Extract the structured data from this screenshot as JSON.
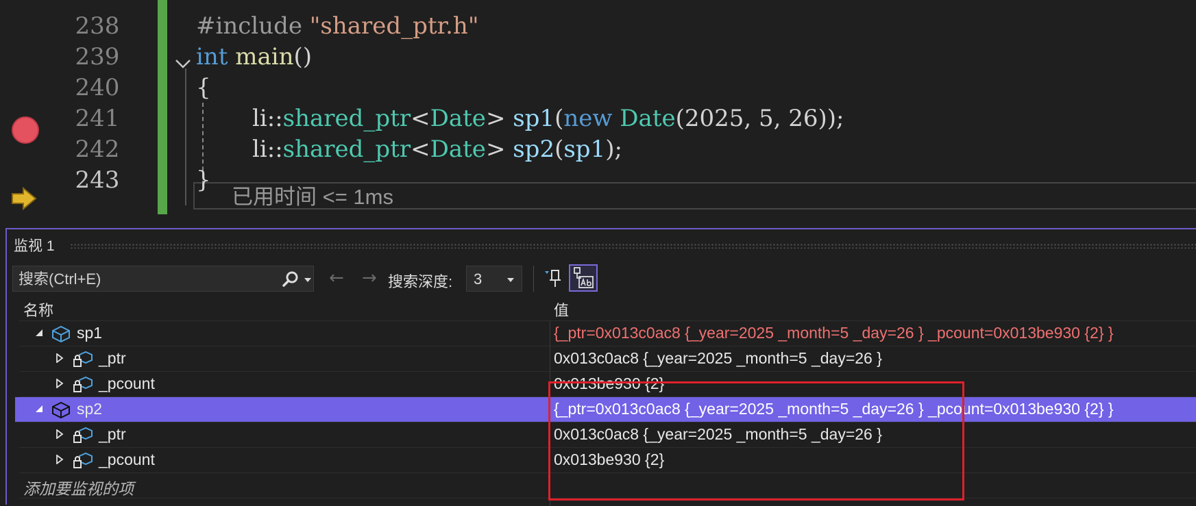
{
  "editor": {
    "lines": [
      {
        "num": "238",
        "include": "#include",
        "header": "\"shared_ptr.h\""
      },
      {
        "num": "239",
        "kw": "int",
        "fn": "main",
        "rest": "()"
      },
      {
        "num": "240",
        "text": "{"
      },
      {
        "num": "241",
        "ns": "li::",
        "ty": "shared_ptr",
        "lt": "<",
        "ty2": "Date",
        "gt": "> ",
        "var": "sp1",
        "open": "(",
        "kwnew": "new",
        "ty3": " Date",
        "args": "(2025, 5, 26));"
      },
      {
        "num": "242",
        "ns": "li::",
        "ty": "shared_ptr",
        "lt": "<",
        "ty2": "Date",
        "gt": "> ",
        "var": "sp2",
        "open": "(",
        "var2": "sp1",
        "close": ");"
      },
      {
        "num": "243",
        "text": "}"
      }
    ],
    "elapsed": "已用时间 <= 1ms"
  },
  "watch": {
    "title": "监视 1",
    "search_placeholder": "搜索(Ctrl+E)",
    "nav_back": "←",
    "nav_forward": "→",
    "depth_label": "搜索深度:",
    "depth_value": "3",
    "columns": {
      "name": "名称",
      "value": "值"
    },
    "rows": [
      {
        "name": "sp1",
        "value": "{_ptr=0x013c0ac8 {_year=2025 _month=5 _day=26 } _pcount=0x013be930 {2} }"
      },
      {
        "name": "_ptr",
        "value": "0x013c0ac8 {_year=2025 _month=5 _day=26 }"
      },
      {
        "name": "_pcount",
        "value": "0x013be930 {2}"
      },
      {
        "name": "sp2",
        "value": "{_ptr=0x013c0ac8 {_year=2025 _month=5 _day=26 } _pcount=0x013be930 {2} }"
      },
      {
        "name": "_ptr",
        "value": "0x013c0ac8 {_year=2025 _month=5 _day=26 }"
      },
      {
        "name": "_pcount",
        "value": "0x013be930 {2}"
      }
    ],
    "add_item": "添加要监视的项"
  },
  "colors": {
    "accent": "#7162e6",
    "breakpoint": "#e5525f",
    "changed_value": "#f07070",
    "highlight_box": "#e0202a",
    "change_bar": "#57a64a"
  }
}
